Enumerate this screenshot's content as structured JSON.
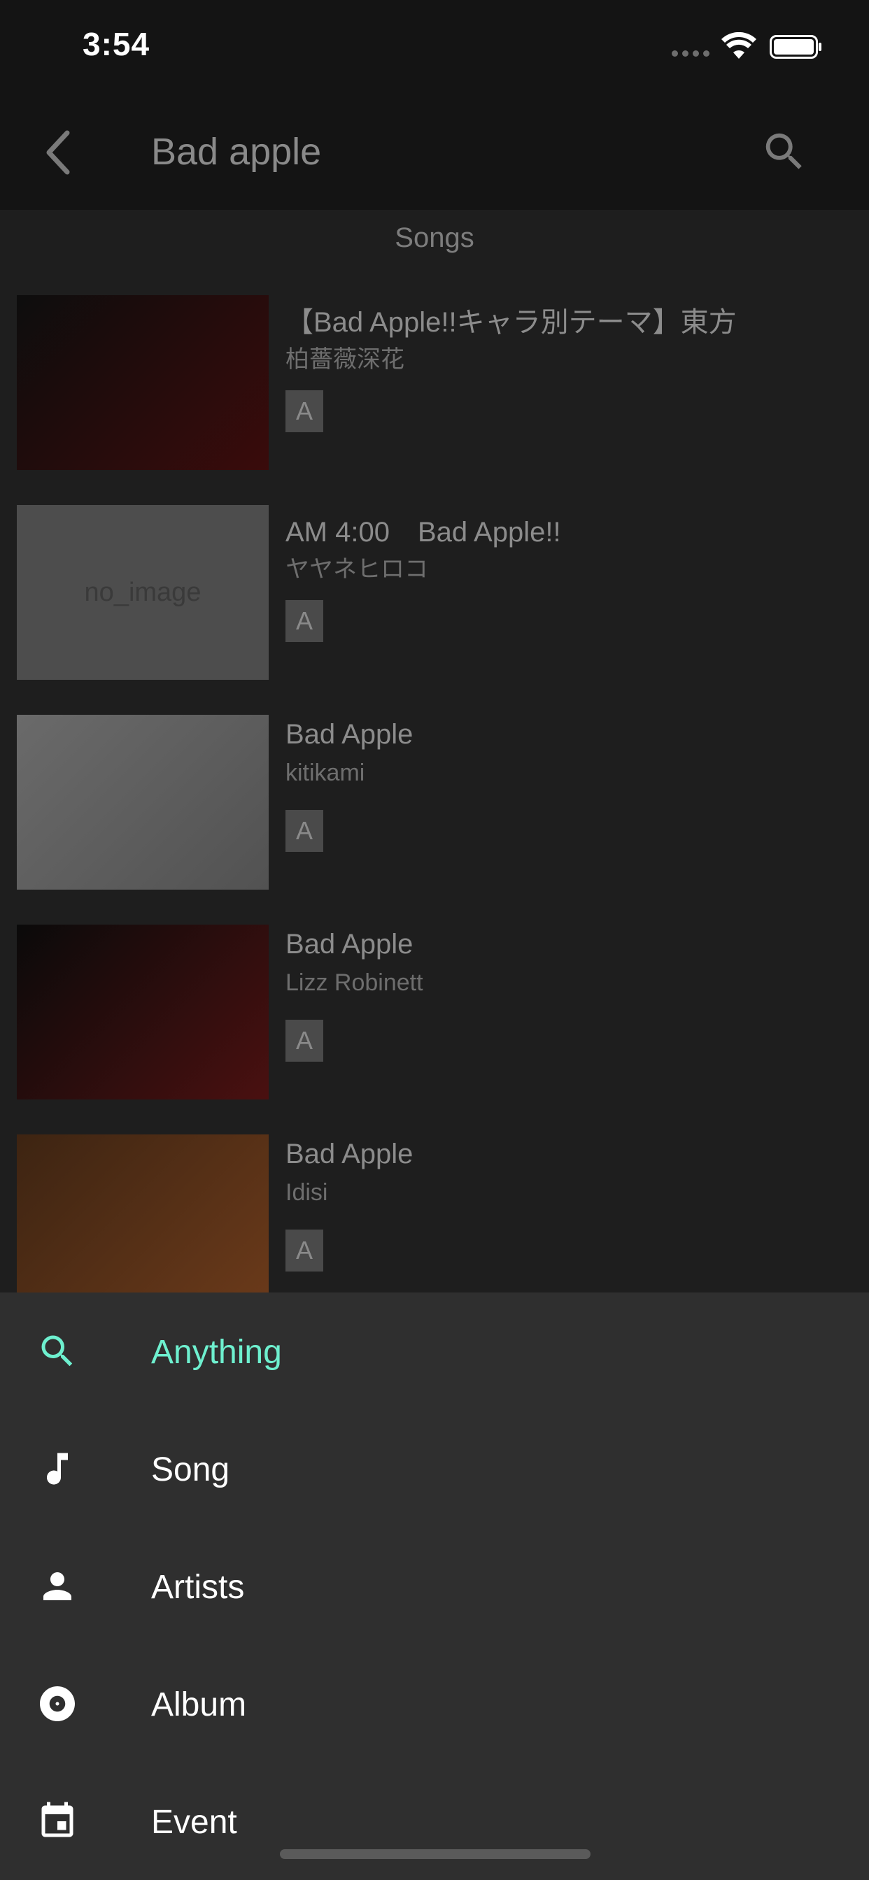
{
  "status_bar": {
    "time": "3:54"
  },
  "header": {
    "title": "Bad apple",
    "back_icon": "chevron-left-icon",
    "search_icon": "search-icon"
  },
  "section_title": "Songs",
  "songs": [
    {
      "title": "【Bad Apple!!キャラ別テーマ】東方",
      "artist": "柏薔薇深花",
      "badge": "A",
      "thumb_colors": [
        "#0d0d0d",
        "#3a0b0b"
      ]
    },
    {
      "title": "AM 4:00　Bad Apple!!",
      "artist": "ヤヤネヒロコ",
      "badge": "A",
      "thumb_colors": [
        "#4d4d4d",
        "#4d4d4d"
      ],
      "thumb_label": "no_image"
    },
    {
      "title": "Bad Apple",
      "artist": "kitikami",
      "badge": "A",
      "thumb_colors": [
        "#6a6a6a",
        "#525252"
      ]
    },
    {
      "title": "Bad Apple",
      "artist": "Lizz Robinett",
      "badge": "A",
      "thumb_colors": [
        "#0a0a0a",
        "#4a1010"
      ]
    },
    {
      "title": "Bad Apple",
      "artist": "Idisi",
      "badge": "A",
      "thumb_colors": [
        "#3d2412",
        "#6b3a1a"
      ]
    }
  ],
  "menu": {
    "accent_color": "#6ef0cf",
    "items": [
      {
        "label": "Anything",
        "icon": "search-icon",
        "active": true
      },
      {
        "label": "Song",
        "icon": "music-note-icon",
        "active": false
      },
      {
        "label": "Artists",
        "icon": "person-icon",
        "active": false
      },
      {
        "label": "Album",
        "icon": "disc-icon",
        "active": false
      },
      {
        "label": "Event",
        "icon": "calendar-icon",
        "active": false
      }
    ]
  }
}
